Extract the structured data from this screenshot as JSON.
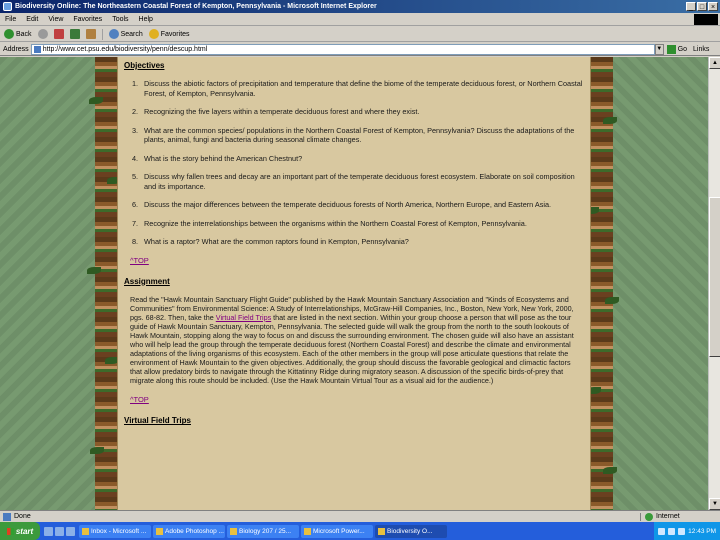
{
  "window": {
    "title": "Biodiversity Online: The Northeastern Coastal Forest of Kempton, Pennsylvania - Microsoft Internet Explorer",
    "controls": [
      "_",
      "□",
      "×"
    ]
  },
  "menu": [
    "File",
    "Edit",
    "View",
    "Favorites",
    "Tools",
    "Help"
  ],
  "toolbar": {
    "back_label": "Back",
    "search_label": "Search",
    "favorites_label": "Favorites"
  },
  "address": {
    "label": "Address",
    "url": "http://www.cet.psu.edu/biodiversity/penn/descup.html",
    "go_label": "Go",
    "links_label": "Links"
  },
  "content": {
    "objectives_heading": "Objectives",
    "objectives": [
      {
        "num": "1.",
        "text": "Discuss the abiotic factors of precipitation and temperature that define the biome of the temperate deciduous forest, or Northern Coastal Forest, of Kempton, Pennsylvania."
      },
      {
        "num": "2.",
        "text": "Recognizing the five layers within a temperate deciduous forest and where they exist."
      },
      {
        "num": "3.",
        "text": "What are the common species/ populations in the Northern Coastal Forest of Kempton, Pennsylvania? Discuss the adaptations of the plants, animal, fungi and bacteria during seasonal climate changes."
      },
      {
        "num": "4.",
        "text": "What is the story behind the American Chestnut?"
      },
      {
        "num": "5.",
        "text": "Discuss why fallen trees and decay are an important part of the temperate deciduous forest ecosystem. Elaborate on soil composition and its importance."
      },
      {
        "num": "6.",
        "text": "Discuss the major differences between the temperate deciduous forests of North America, Northern Europe, and Eastern Asia."
      },
      {
        "num": "7.",
        "text": "Recognize the interrelationships between the organisms within the Northern Coastal Forest of Kempton, Pennsylvania."
      },
      {
        "num": "8.",
        "text": "What is a raptor? What are the common raptors found in Kempton, Pennsylvania?"
      }
    ],
    "top_link": "^TOP",
    "assignment_heading": "Assignment",
    "assignment_before_link": "Read the \"Hawk Mountain Sanctuary Flight Guide\" published by the Hawk Mountain Sanctuary Association and \"Kinds of Ecosystems and Communities\" from Environmental Science: A Study of Interrelationships, McGraw-Hill Companies, Inc., Boston, New York, New York, 2000, pgs. 68-82. Then, take the ",
    "assignment_link": "Virtual Field Trips",
    "assignment_after_link": " that are listed in the next section. Within your group choose a person that will pose as the tour guide of Hawk Mountain Sanctuary, Kempton, Pennsylvania. The selected guide will walk the group from the north to the south lookouts of Hawk Mountain, stopping along the way to focus on and discuss the surrounding environment. The chosen guide will also have an assistant who will help lead the group through the temperate deciduous forest (Northern Coastal Forest) and describe the climate and environmental adaptations of the living organisms of this ecosystem. Each of the other members in the group will pose articulate questions that relate the environment of Hawk Mountain to the given objectives. Additionally, the group should discuss the favorable geological and climactic factors that allow predatory birds to navigate through the Kittatinny Ridge during migratory season. A discussion of the specific birds-of-prey that migrate along this route should be included. (Use the Hawk Mountain Virtual Tour as a visual aid for the audience.)",
    "top_link_2": "^TOP",
    "vft_heading": "Virtual Field Trips"
  },
  "status": {
    "text": "Done",
    "zone": "Internet"
  },
  "taskbar": {
    "start": "start",
    "tasks": [
      {
        "label": "Inbox - Microsoft ...",
        "active": false
      },
      {
        "label": "Adobe Photoshop ...",
        "active": false
      },
      {
        "label": "Biology 207 / 25...",
        "active": false
      },
      {
        "label": "Microsoft Power...",
        "active": false
      },
      {
        "label": "Biodiversity O...",
        "active": true
      }
    ],
    "clock": "12:43 PM"
  }
}
